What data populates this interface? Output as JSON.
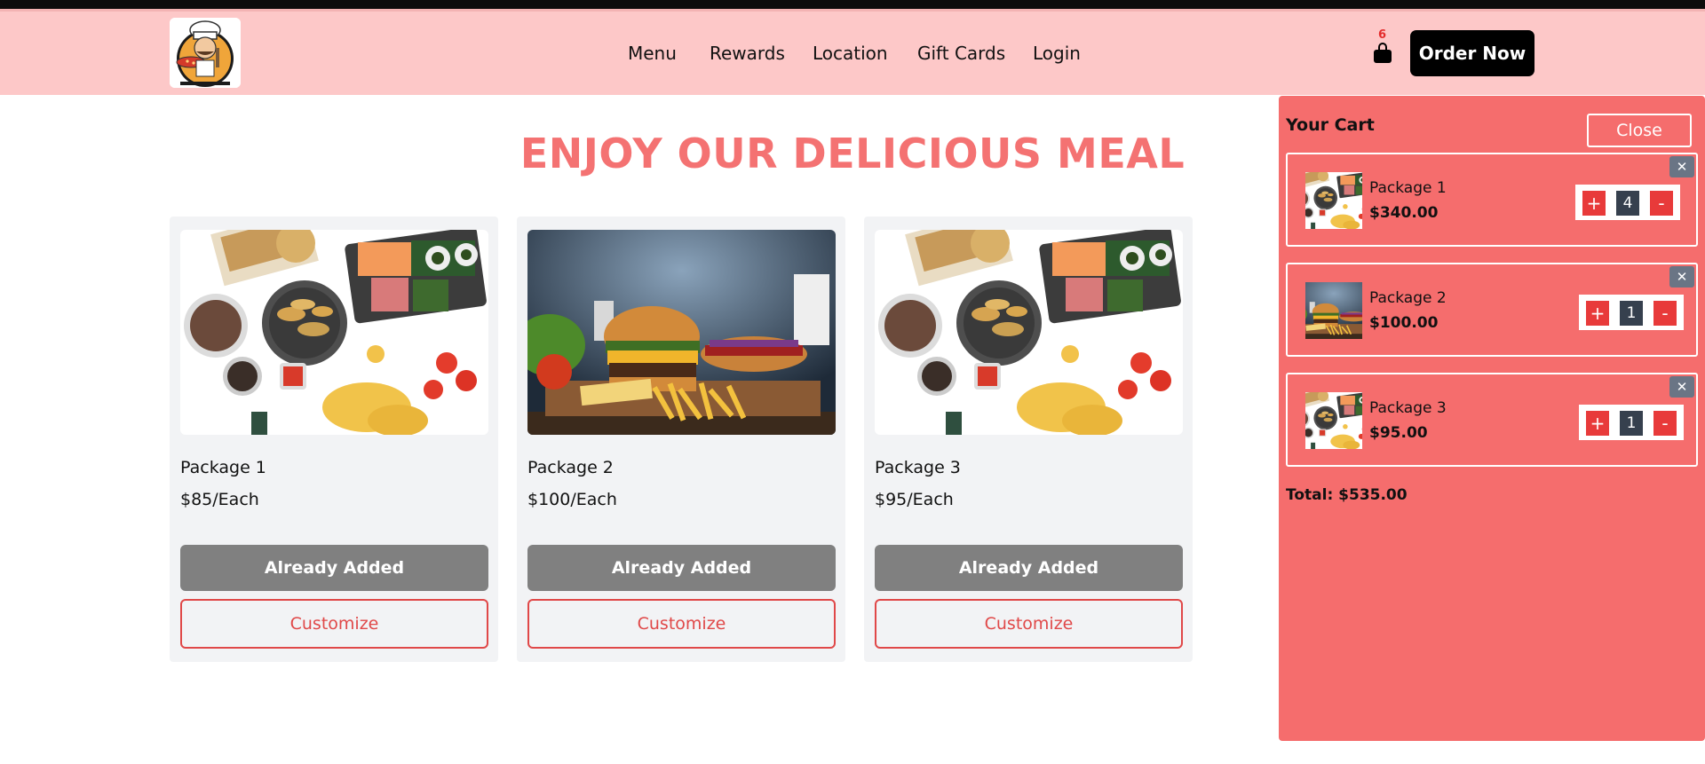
{
  "header": {
    "nav": [
      "Menu",
      "Rewards",
      "Location",
      "Gift Cards",
      "Login"
    ],
    "cart_count": "6",
    "order_button": "Order Now"
  },
  "hero": {
    "title": "ENJOY OUR DELICIOUS MEAL"
  },
  "products": [
    {
      "name": "Package 1",
      "price": "$85/Each",
      "added_label": "Already Added",
      "customize_label": "Customize",
      "image": "food-spread"
    },
    {
      "name": "Package 2",
      "price": "$100/Each",
      "added_label": "Already Added",
      "customize_label": "Customize",
      "image": "burger-meal"
    },
    {
      "name": "Package 3",
      "price": "$95/Each",
      "added_label": "Already Added",
      "customize_label": "Customize",
      "image": "food-spread"
    }
  ],
  "cart": {
    "title": "Your Cart",
    "close_label": "Close",
    "items": [
      {
        "name": "Package 1",
        "price": "$340.00",
        "qty": "4",
        "plus": "+",
        "minus": "-",
        "remove": "✕",
        "image": "food-spread"
      },
      {
        "name": "Package 2",
        "price": "$100.00",
        "qty": "1",
        "plus": "+",
        "minus": "-",
        "remove": "✕",
        "image": "burger-meal"
      },
      {
        "name": "Package 3",
        "price": "$95.00",
        "qty": "1",
        "plus": "+",
        "minus": "-",
        "remove": "✕",
        "image": "food-spread"
      }
    ],
    "total": "Total: $535.00"
  },
  "colors": {
    "header_bg": "#fdc8c8",
    "accent": "#f47272",
    "cart_bg": "#f56d6d",
    "button_dark": "#000000",
    "added_bg": "#808080",
    "customize": "#e04848"
  }
}
